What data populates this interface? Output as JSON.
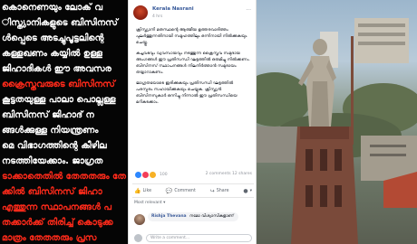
{
  "poster": {
    "lines": [
      {
        "text": "കൊനെണയും ലോക് വ",
        "color": "white"
      },
      {
        "text": "ിസ്ത്യാനികളുടെ ബിസിനസ്",
        "color": "white"
      },
      {
        "text": "ൾപ്പെടെ  അടച്ചുപൂട്ടലിന്റെ",
        "color": "white"
      },
      {
        "text": "കള്ളഖണം കയ്യിൽ ഉള്ള",
        "color": "white"
      },
      {
        "text": "ജിഹാദികൾ ഈ അവസര",
        "color": "white"
      },
      {
        "text": "ക്രൈസ്തവരുടെ ബിസിനസ്",
        "color": "red"
      },
      {
        "text": "കൂട്ടതയുള്ള പാലാ പൊല്ലള്ള",
        "color": "white"
      },
      {
        "text": "ബിസിനസ്  ജിഹാദ് ന",
        "color": "white"
      },
      {
        "text": "ങ്ങൾക്കുള്ള നിയന്ത്രണം",
        "color": "white"
      },
      {
        "text": "മെ വിഭാഗത്തിന്റെ കീഴില",
        "color": "white"
      },
      {
        "text": "നടത്തിയേക്കാം. ജാഗ്രത",
        "color": "white"
      },
      {
        "text": "ടാക്കാതെതിൽ തേതതരും തേ",
        "color": "red"
      },
      {
        "text": "ക്കിൽ ബിസിനസ്  ജിഹാ",
        "color": "red"
      },
      {
        "text": "എത്തുന്ന സ്ഥാപനങ്ങൾ പ",
        "color": "red"
      },
      {
        "text": "തക്കാർക്ക് തിരിച്ച് കൊടുക്ക",
        "color": "red"
      },
      {
        "text": "മാത്രം തേതതരും പ്രസ",
        "color": "red"
      }
    ]
  },
  "post": {
    "page_name": "Kerala Nasrani",
    "time": "4 hrs",
    "menu_glyph": "···",
    "paragraphs": [
      "ക്രിസ്ത്യാനി മതസ്ഥന്റെ ആത്മീയ ഉത്തരവാദിത്തം പുലർത്തുന്നതിനായി സമൂഹത്തിലും ഒന്നിനായി നിൽക്കുകയും ചെയ്തു.",
      "കച്ചവടവും വ്യവസായവും നടത്തുന്ന ക്രൈസ്തവ സമുദായ അംഗങ്ങൾ ഈ പ്രതിസന്ധി ഘട്ടത്തിൽ ഒരുമിച്ചു നിൽക്കണം. ബിസിനസ് സ്ഥാപനങ്ങൾ നിലനിർത്താൻ സമുദായം തയ്യാറാകണം.",
      "ജാഗ്രതയോടെ ഇരിക്കുകയും പ്രതിസന്ധി ഘട്ടത്തിൽ പരസ്പരം സഹായിക്കുകയും ചെയ്യുക. ക്രിസ്ത്യൻ ബിസിനസുകാർ ഒന്നിച്ചു നിന്നാൽ ഈ പ്രതിസന്ധിയെ മറികടക്കാം."
    ],
    "reaction_count": "100",
    "comments_shares": "2 comments  12 shares",
    "actions": {
      "like": "Like",
      "comment": "Comment",
      "share": "Share"
    },
    "most_relevant": "Most relevant ▾",
    "comment": {
      "author": "Rishja Thevana",
      "text": "നമോ വിശ്വാസികളാണ്"
    },
    "write_placeholder": "Write a comment..."
  },
  "colors": {
    "poster_red": "#ff2a1a",
    "facebook_blue": "#365899",
    "card_bg": "#ffffff"
  }
}
